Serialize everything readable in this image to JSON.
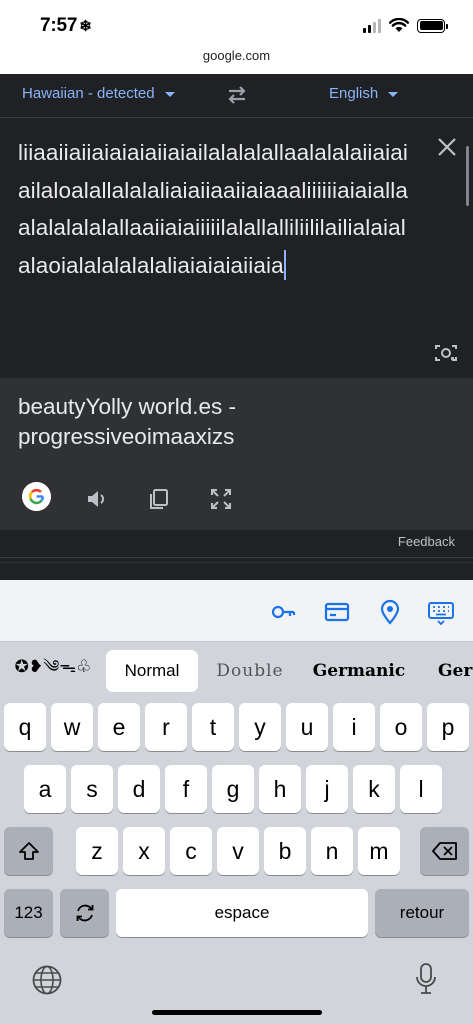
{
  "status": {
    "time": "7:57",
    "time_icon": "❄"
  },
  "url": "google.com",
  "translate": {
    "source_lang": "Hawaiian - detected",
    "target_lang": "English",
    "source_text": "liiaaiiaiiaiaiaiaiiaiailalalalallaalalalaiiaiaiailaloalallalalaliaiaiiaaiiaiaaaliiiiiiaiaiallaalalalalalallaaiiaiaiiiiilalallalliliililailialaialalaoialalalalalaliaiaiaiaiiaia",
    "result_text": "beautyYolly world.es - progressiveoimaaxizs",
    "feedback": "Feedback"
  },
  "keyboard": {
    "fonts": [
      "✪❥༄ᯓ♧",
      "Normal",
      "Double",
      "Germanic",
      "Ger"
    ],
    "row1": [
      "q",
      "w",
      "e",
      "r",
      "t",
      "y",
      "u",
      "i",
      "o",
      "p"
    ],
    "row2": [
      "a",
      "s",
      "d",
      "f",
      "g",
      "h",
      "j",
      "k",
      "l"
    ],
    "row3": [
      "z",
      "x",
      "c",
      "v",
      "b",
      "n",
      "m"
    ],
    "numbers_key": "123",
    "space_key": "espace",
    "return_key": "retour"
  }
}
